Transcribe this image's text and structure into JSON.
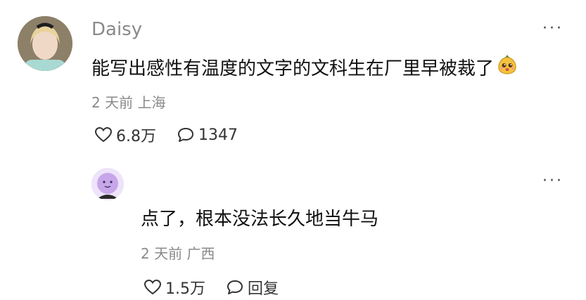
{
  "comment": {
    "username": "Daisy",
    "text": "能写出感性有温度的文字的文科生在厂里早被裁了",
    "emoji": "worried-chestnut-emoji",
    "meta": "2 天前 上海",
    "likes": "6.8万",
    "replies": "1347",
    "more": "···"
  },
  "reply": {
    "text": "点了，根本没法长久地当牛马",
    "meta": "2 天前 广西",
    "likes": "1.5万",
    "reply_label": "回复",
    "more": "···"
  },
  "icons": {
    "like": "heart-outline-icon",
    "comment": "speech-bubble-icon",
    "more": "more-dots-icon"
  }
}
